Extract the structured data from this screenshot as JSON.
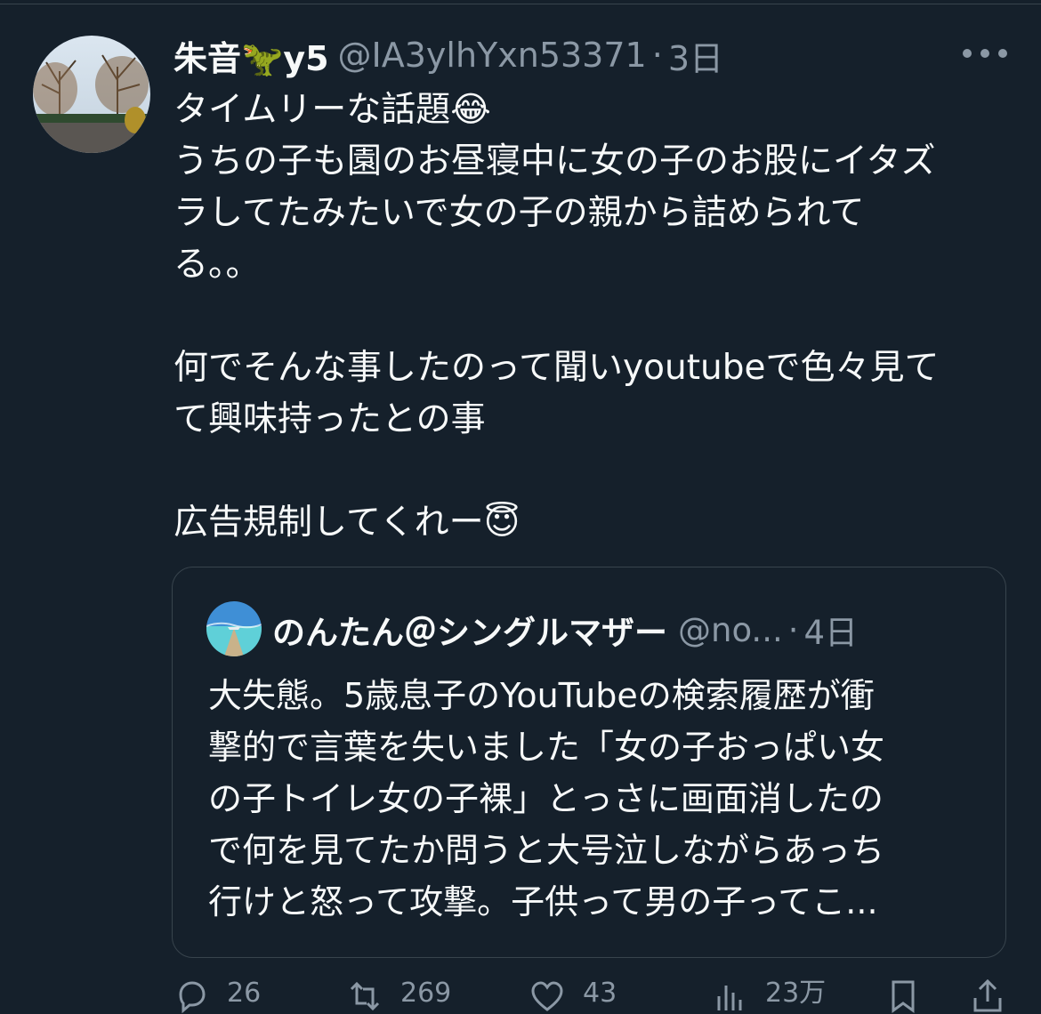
{
  "tweet": {
    "display_name": "朱音🦖y5",
    "handle": "@IA3ylhYxn53371",
    "separator": "·",
    "time": "3日",
    "lines": [
      "タイムリーな話題😂",
      "うちの子も園のお昼寝中に女の子のお股にイタズ",
      "ラしてたみたいで女の子の親から詰められて",
      "る。。",
      "",
      "何でそんな事したのって聞いyoutubeで色々見て",
      "て興味持ったとの事",
      "",
      "広告規制してくれー😇"
    ]
  },
  "quote": {
    "display_name": "のんたん＠シングルマザー",
    "handle": "@no...",
    "separator": "·",
    "time": "4日",
    "lines": [
      "大失態。5歳息子のYouTubeの検索履歴が衝",
      "撃的で言葉を失いました「女の子おっぱい女",
      "の子トイレ女の子裸」とっさに画面消したの",
      "で何を見てたか問うと大号泣しながらあっち",
      "行けと怒って攻撃。子供って男の子ってこ..."
    ]
  },
  "actions": {
    "reply_count": "26",
    "retweet_count": "269",
    "like_count": "43",
    "views_count": "23万"
  },
  "icons": {
    "more": "more-icon",
    "reply": "reply-icon",
    "retweet": "retweet-icon",
    "like": "heart-icon",
    "views": "views-icon",
    "bookmark": "bookmark-icon",
    "share": "share-icon"
  },
  "colors": {
    "background": "#15202b",
    "text": "#f7f9f9",
    "secondary": "#8b98a5",
    "border": "#38444d"
  }
}
